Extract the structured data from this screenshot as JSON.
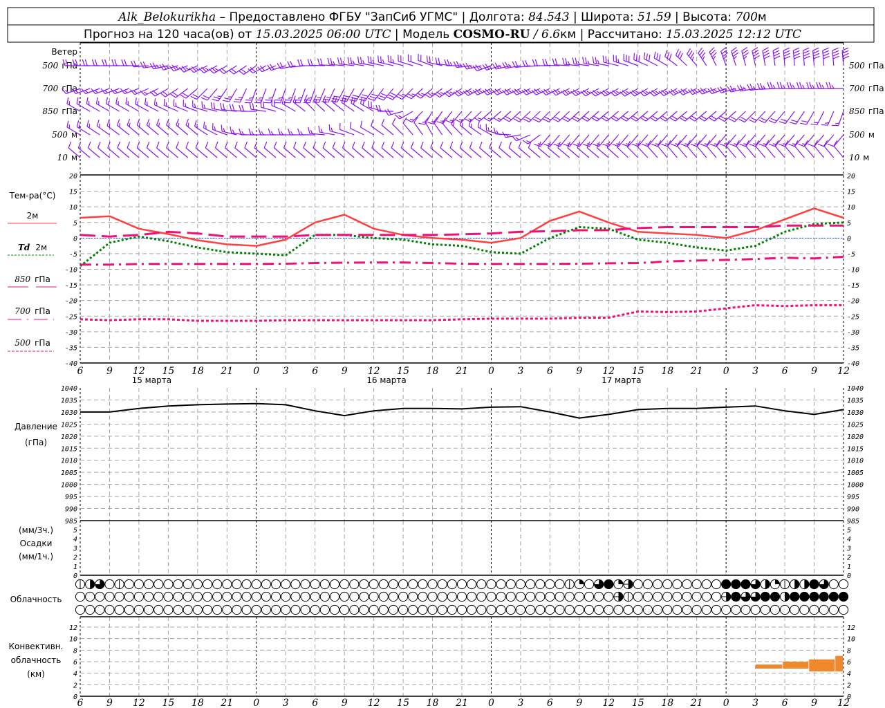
{
  "header": {
    "station": "Alk_Belokurikha",
    "provider": " – Предоставлено ФГБУ \"ЗапСиб УГМС\" | Долгота: ",
    "lon": "84.543",
    "lat_label": " | Широта: ",
    "lat": "51.59",
    "alt_label": " | Высота: ",
    "alt": "700",
    "alt_unit": "м",
    "forecast_label": "Прогноз на 120 часа(ов) от ",
    "forecast_time": "15.03.2025 06:00 UTC",
    "model_label": "  | Модель ",
    "model": "COSMO-RU",
    "res": " / 6.6",
    "res_unit": "км",
    "calc_label": " | Рассчитано: ",
    "calc_time": "15.03.2025 12:12 UTC"
  },
  "labels": {
    "wind": "Ветер",
    "wind_levels": [
      {
        "num": "500",
        "unit": "гПа"
      },
      {
        "num": "700",
        "unit": "гПа"
      },
      {
        "num": "850",
        "unit": "гПа"
      },
      {
        "num": "500",
        "unit": "м"
      },
      {
        "num": "10",
        "unit": "м"
      }
    ],
    "temp_title": "Тем-ра(°C)",
    "t2m": "2м",
    "td": "Td",
    "td_unit": "2м",
    "l850": "850",
    "l700": "700",
    "l500": "500",
    "gpa": "гПа",
    "pressure": "Давление",
    "pressure_unit": "(гПа)",
    "precip_3h": "(мм/3ч.)",
    "precip": "Осадки",
    "precip_1h": "(мм/1ч.)",
    "clouds": "Облачность",
    "conv1": "Конвективн.",
    "conv2": "облачность",
    "conv3": "(км)"
  },
  "colors": {
    "wind": "#8a14f0",
    "t2m": "#ff4040",
    "td": "#008000",
    "upper": "#ee1177",
    "zero": "#2040ff",
    "pressure": "#000000",
    "conv": "#f0882c"
  },
  "x_axis": {
    "hour_labels": [
      "6",
      "9",
      "12",
      "15",
      "18",
      "21",
      "0",
      "3",
      "6",
      "9",
      "12",
      "15",
      "18",
      "21",
      "0",
      "3",
      "6",
      "9",
      "12",
      "15",
      "18",
      "21",
      "0",
      "3",
      "6",
      "9",
      "12"
    ],
    "day_labels": [
      "15 марта",
      "16 марта",
      "17 марта"
    ]
  },
  "chart_data": [
    {
      "type": "barbs",
      "title": "Ветер",
      "levels": [
        "500 гПа",
        "700 гПа",
        "850 гПа",
        "500 м",
        "10 м"
      ],
      "key_hours": [
        0,
        6,
        12,
        18,
        24,
        30,
        36,
        42,
        48,
        54,
        60,
        66,
        72,
        78
      ],
      "direction_deg": [
        [
          270,
          270,
          245,
          235,
          270,
          280,
          290,
          250,
          270,
          280,
          300,
          340,
          355,
          355
        ],
        [
          250,
          250,
          230,
          200,
          200,
          215,
          230,
          245,
          245,
          240,
          240,
          250,
          270,
          270
        ],
        [
          300,
          300,
          290,
          270,
          315,
          300,
          210,
          230,
          225,
          230,
          230,
          230,
          220,
          200
        ],
        [
          300,
          310,
          310,
          270,
          270,
          300,
          330,
          300,
          220,
          220,
          220,
          220,
          220,
          220
        ],
        [
          310,
          310,
          310,
          310,
          310,
          310,
          310,
          310,
          310,
          310,
          320,
          320,
          320,
          320
        ]
      ],
      "speed_ms": [
        [
          8,
          8,
          10,
          8,
          8,
          10,
          8,
          10,
          8,
          10,
          12,
          14,
          16,
          16
        ],
        [
          6,
          6,
          8,
          10,
          10,
          12,
          10,
          10,
          10,
          10,
          10,
          10,
          10,
          10
        ],
        [
          6,
          6,
          6,
          8,
          6,
          8,
          6,
          6,
          8,
          8,
          8,
          8,
          8,
          6
        ],
        [
          6,
          6,
          6,
          6,
          6,
          4,
          4,
          6,
          6,
          6,
          6,
          6,
          6,
          4
        ],
        [
          4,
          4,
          3,
          3,
          3,
          3,
          4,
          4,
          4,
          4,
          4,
          4,
          4,
          4
        ]
      ]
    },
    {
      "type": "line",
      "title": "Тем-ра(°C)",
      "ylim": [
        -40,
        20
      ],
      "yticks": [
        20,
        15,
        10,
        5,
        0,
        -5,
        -10,
        -15,
        -20,
        -25,
        -30,
        -35,
        -40
      ],
      "x_step_hours": 3,
      "series": [
        {
          "name": "2м",
          "values": [
            6.5,
            7,
            3,
            1.3,
            -0.7,
            -2,
            -2.5,
            -0.5,
            5,
            7.5,
            3,
            1,
            0,
            -0.5,
            -1.5,
            0,
            5.5,
            8.5,
            5,
            2,
            1.5,
            1,
            0,
            2.5,
            6,
            9.5,
            6.5
          ]
        },
        {
          "name": "Td 2м",
          "values": [
            -9,
            -1.5,
            0.5,
            -1,
            -3,
            -4.5,
            -5,
            -5.5,
            1,
            1,
            0,
            -0.5,
            -2,
            -2.5,
            -4.5,
            -5,
            0,
            3.5,
            3,
            -0.5,
            -1.5,
            -3,
            -4,
            -2.5,
            2,
            4.5,
            5
          ]
        },
        {
          "name": "850 гПа",
          "values": [
            1,
            0.5,
            1,
            2,
            1.5,
            0.5,
            0.5,
            0.5,
            1,
            1,
            1,
            1,
            1,
            1.2,
            1.5,
            2,
            2.2,
            2.5,
            2.5,
            3.2,
            3.5,
            3.5,
            3.5,
            3.5,
            4,
            4,
            4
          ]
        },
        {
          "name": "700 гПа",
          "values": [
            -8.5,
            -8.5,
            -8.3,
            -8.3,
            -8.3,
            -8.3,
            -8.3,
            -8.2,
            -8,
            -7.9,
            -7.8,
            -7.8,
            -8,
            -8.2,
            -8.3,
            -8.3,
            -8.3,
            -8.2,
            -8.1,
            -8,
            -7.5,
            -7.2,
            -7,
            -6.7,
            -6.3,
            -6.5,
            -6
          ]
        },
        {
          "name": "500 гПа",
          "values": [
            -26,
            -26.3,
            -26,
            -26,
            -26.5,
            -26.5,
            -26.5,
            -26.3,
            -26.3,
            -26.3,
            -26.3,
            -26.3,
            -26.3,
            -26,
            -25.8,
            -25.8,
            -25.8,
            -25.5,
            -25.5,
            -23.5,
            -23.7,
            -23.5,
            -22.5,
            -21.5,
            -21.8,
            -21.5,
            -21.5
          ]
        }
      ]
    },
    {
      "type": "line",
      "title": "Давление (гПа)",
      "ylim": [
        985,
        1040
      ],
      "yticks": [
        1040,
        1035,
        1030,
        1025,
        1020,
        1015,
        1010,
        1005,
        1000,
        995,
        990,
        985
      ],
      "x_step_hours": 3,
      "values": [
        1030,
        1030,
        1031.5,
        1032.5,
        1033,
        1033.3,
        1033.5,
        1033,
        1030.5,
        1028.5,
        1030.5,
        1031.5,
        1031.5,
        1031.3,
        1032,
        1032.2,
        1030,
        1027.5,
        1029,
        1031,
        1031.5,
        1031.5,
        1032,
        1032.5,
        1030.5,
        1029,
        1031
      ]
    },
    {
      "type": "bar",
      "title": "Осадки",
      "ylim": [
        0,
        5
      ],
      "yticks": [
        5,
        4,
        3,
        2,
        1,
        0
      ],
      "values": []
    },
    {
      "type": "table",
      "title": "Облачность",
      "rows": [
        [
          1,
          4,
          6,
          0,
          1,
          0,
          0,
          0,
          0,
          0,
          0,
          0,
          0,
          0,
          0,
          0,
          0,
          0,
          0,
          0,
          0,
          0,
          0,
          0,
          0,
          0,
          0,
          0,
          0,
          0,
          0,
          0,
          0,
          0,
          0,
          0,
          0,
          0,
          0,
          0,
          0,
          0,
          0,
          0,
          0,
          0,
          0,
          0,
          0,
          0,
          1,
          2,
          0,
          6,
          8,
          2,
          9,
          0,
          0,
          0,
          0,
          0,
          0,
          0,
          0,
          0,
          8,
          8,
          8,
          6,
          4,
          2,
          1,
          4,
          4,
          8,
          6,
          0,
          0
        ],
        [
          0,
          0,
          0,
          0,
          0,
          0,
          0,
          0,
          0,
          0,
          0,
          0,
          0,
          0,
          0,
          0,
          0,
          0,
          0,
          0,
          0,
          0,
          0,
          0,
          0,
          0,
          0,
          0,
          0,
          0,
          0,
          0,
          0,
          0,
          0,
          0,
          0,
          0,
          0,
          0,
          0,
          0,
          0,
          0,
          0,
          0,
          0,
          0,
          0,
          0,
          0,
          0,
          0,
          0,
          0,
          9,
          1,
          0,
          0,
          0,
          0,
          0,
          0,
          0,
          0,
          0,
          9,
          8,
          6,
          6,
          8,
          8,
          4,
          8,
          8,
          8,
          8,
          8,
          8
        ],
        [
          0,
          0,
          0,
          0,
          0,
          0,
          0,
          0,
          0,
          0,
          0,
          0,
          0,
          0,
          0,
          0,
          0,
          0,
          0,
          0,
          0,
          0,
          0,
          0,
          0,
          0,
          0,
          0,
          0,
          0,
          0,
          0,
          0,
          0,
          0,
          0,
          0,
          0,
          0,
          0,
          0,
          0,
          0,
          0,
          0,
          0,
          0,
          0,
          0,
          0,
          0,
          0,
          0,
          0,
          0,
          0,
          0,
          0,
          0,
          0,
          0,
          0,
          0,
          0,
          0,
          0,
          0,
          0,
          0,
          0,
          0,
          0,
          0,
          0,
          0,
          0,
          0,
          0,
          0
        ]
      ]
    },
    {
      "type": "bar",
      "title": "Конвективн. облачность (км)",
      "ylim": [
        0,
        13
      ],
      "yticks": [
        12,
        10,
        8,
        6,
        4,
        2,
        0
      ],
      "bars": [
        {
          "h0": 74.6,
          "h1": 77.6,
          "base": 4.8,
          "top": 5.5
        },
        {
          "h0": 77.6,
          "h1": 80.5,
          "base": 4.8,
          "top": 6.0
        },
        {
          "h0": 80.5,
          "h1": 83.4,
          "base": 4.3,
          "top": 6.4
        },
        {
          "h0": 83.4,
          "h1": 84.3,
          "base": 4.3,
          "top": 7.0
        }
      ]
    }
  ]
}
